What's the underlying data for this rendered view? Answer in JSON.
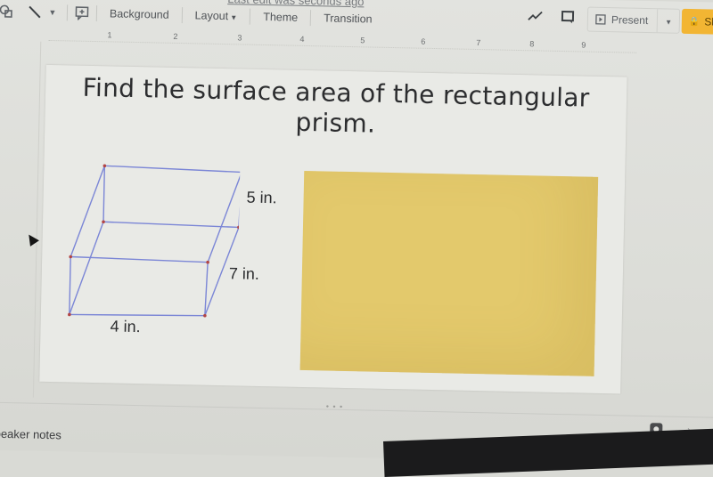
{
  "header": {
    "last_edit": "Last edit was seconds ago",
    "present_label": "Present",
    "share_label": "Share"
  },
  "toolbar": {
    "items": [
      {
        "name": "shape-tool",
        "icon": "shape-icon"
      },
      {
        "name": "line-tool",
        "icon": "line-icon"
      },
      {
        "name": "line-dropdown",
        "icon": "chevron-down-icon"
      },
      {
        "name": "comment-tool",
        "icon": "add-comment-icon"
      }
    ],
    "background_label": "Background",
    "layout_label": "Layout",
    "theme_label": "Theme",
    "transition_label": "Transition"
  },
  "ruler": {
    "ticks": [
      "1",
      "2",
      "3",
      "4",
      "5",
      "6",
      "7",
      "8",
      "9"
    ]
  },
  "slide": {
    "title": "Find the surface area of the rectangular prism.",
    "dimensions": {
      "height": "5 in.",
      "depth": "7 in.",
      "width": "4 in."
    },
    "colors": {
      "edge": "#7b86d6",
      "vertex": "#b24545",
      "answer_box": "#e3c96c"
    }
  },
  "footer": {
    "speaker_notes_label": "Speaker notes",
    "notes_handle": "• • •"
  }
}
